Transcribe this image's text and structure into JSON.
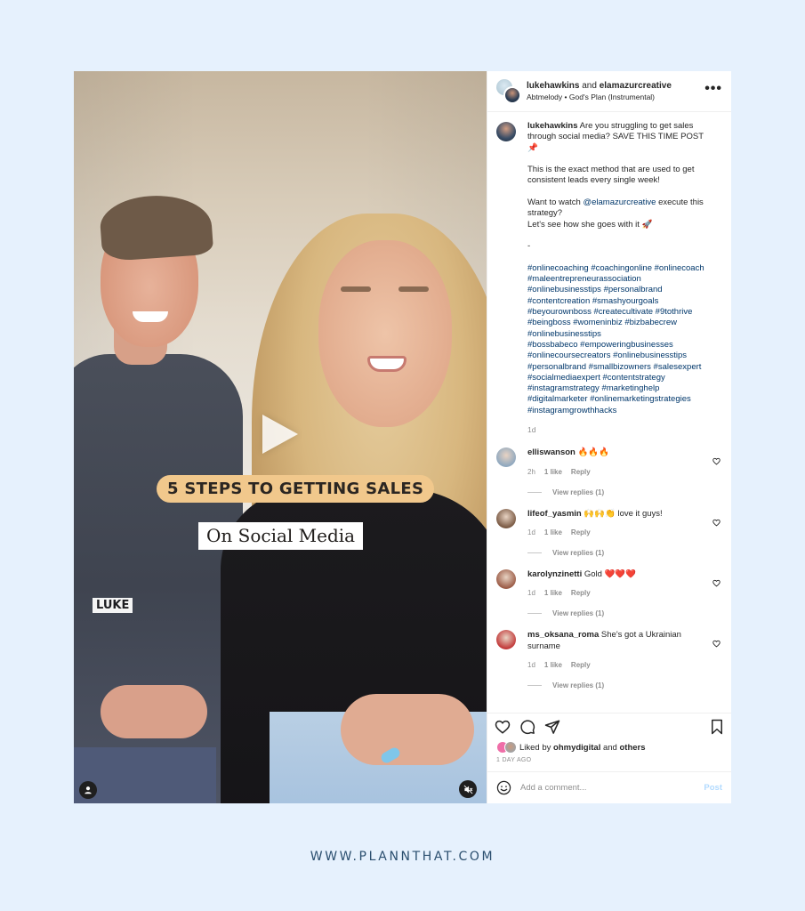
{
  "header": {
    "user1": "lukehawkins",
    "joiner": "and",
    "user2": "elamazurcreative",
    "audio_artist": "Abtmelody",
    "audio_separator": "•",
    "audio_track": "God's Plan (Instrumental)",
    "more_icon": "more-horizontal-icon",
    "more_label": "•••"
  },
  "media": {
    "caption_pill": "5 STEPS TO GETTING SALES",
    "caption_box": "On Social Media",
    "name_tag": "LUKE",
    "play_icon": "play-icon",
    "tag_icon": "user-tag-icon",
    "mute_icon": "muted-speaker-icon"
  },
  "caption": {
    "username": "lukehawkins",
    "line1": " Are you struggling to get sales through social media? SAVE THIS TIME POST ",
    "pin_emoji": "📌",
    "para2": "This is the exact method that are used to get consistent leads every single week!",
    "para3_before": "Want to watch ",
    "mention": "@elamazurcreative",
    "para3_after": " execute this strategy?",
    "para3_line2": "Let's see how she goes with it ",
    "rocket_emoji": "🚀",
    "dash": "-",
    "hashtags": [
      "#onlinecoaching",
      "#coachingonline",
      "#onlinecoach",
      "#maleentrepreneurassociation",
      "#onlinebusinesstips",
      "#personalbrand",
      "#contentcreation",
      "#smashyourgoals",
      "#beyourownboss",
      "#createcultivate",
      "#9tothrive",
      "#beingboss",
      "#womeninbiz",
      "#bizbabecrew",
      "#onlinebusinesstips",
      "#bossbabeco",
      "#empoweringbusinesses",
      "#onlinecoursecreators",
      "#onlinebusinesstips",
      "#personalbrand",
      "#smallbizowners",
      "#salesexpert",
      "#socialmediaexpert",
      "#contentstrategy",
      "#instagramstrategy",
      "#marketinghelp",
      "#digitalmarketer",
      "#onlinemarketingstrategies",
      "#instagramgrowthhacks"
    ],
    "time": "1d"
  },
  "comments": [
    {
      "username": "elliswanson",
      "text": " 🔥🔥🔥",
      "time": "2h",
      "likes": "1 like",
      "reply": "Reply",
      "view_replies": "View replies (1)",
      "avatar_color": "#8fa8bf"
    },
    {
      "username": "lifeof_yasmin",
      "text": " 🙌🙌👏 love it guys!",
      "time": "1d",
      "likes": "1 like",
      "reply": "Reply",
      "view_replies": "View replies (1)",
      "avatar_color": "#7a5a44"
    },
    {
      "username": "karolynzinetti",
      "text": " Gold ❤️❤️❤️",
      "time": "1d",
      "likes": "1 like",
      "reply": "Reply",
      "view_replies": "View replies (1)",
      "avatar_color": "#9c5d48"
    },
    {
      "username": "ms_oksana_roma",
      "text": " She's got a Ukrainian surname",
      "time": "1d",
      "likes": "1 like",
      "reply": "Reply",
      "view_replies": "View replies (1)",
      "avatar_color": "#c23a3a"
    }
  ],
  "actions": {
    "like_icon": "heart-icon",
    "comment_icon": "comment-bubble-icon",
    "share_icon": "paper-plane-icon",
    "save_icon": "bookmark-icon"
  },
  "likes": {
    "prefix": "Liked by ",
    "user": "ohmydigital",
    "middle": " and ",
    "others": "others"
  },
  "post_age": "1 DAY AGO",
  "comment_box": {
    "placeholder": "Add a comment...",
    "value": "",
    "post_label": "Post",
    "emoji_icon": "smiley-icon"
  },
  "footer": {
    "url": "WWW.PLANNTHAT.COM"
  },
  "colors": {
    "background": "#e6f1fd",
    "link": "#00376b",
    "post_button_disabled": "#b3dbff",
    "caption_pill": "#f1c88c",
    "footer_text": "#2b4f6f"
  }
}
